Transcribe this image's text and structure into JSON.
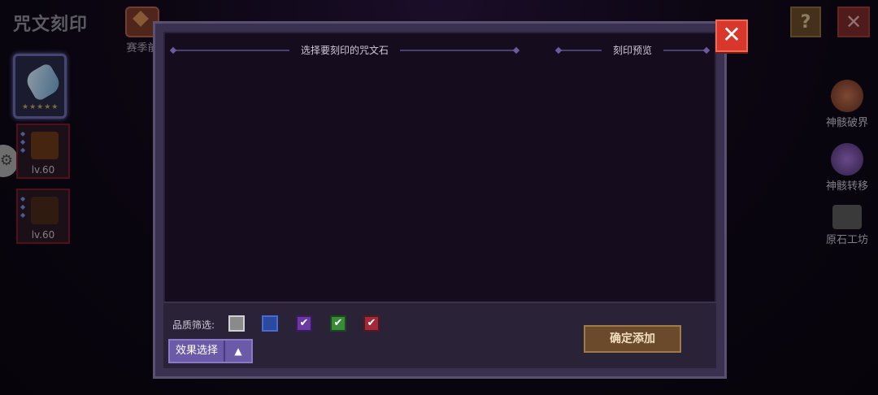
{
  "page": {
    "title": "咒文刻印"
  },
  "top_bar": {
    "season_label": "赛季前",
    "help_label": "?",
    "close_label": "✕"
  },
  "left_items": [
    {
      "selected": true,
      "stars": "★★★★★"
    },
    {
      "level": "lv.60"
    },
    {
      "level": "lv.60"
    }
  ],
  "right_menu": [
    {
      "label": "神骸破界",
      "icon": "relic-break-icon"
    },
    {
      "label": "神骸转移",
      "icon": "relic-transfer-icon"
    },
    {
      "label": "原石工坊",
      "icon": "workshop-icon"
    }
  ],
  "modal": {
    "left_header": "选择要刻印的咒文石",
    "right_header": "刻印预览",
    "close_label": "✕",
    "filter_label": "品质筛选:",
    "quality_filters": [
      {
        "color": "#8a8a8a",
        "checked": false
      },
      {
        "color": "#2a4aa0",
        "checked": false
      },
      {
        "color": "#6a3aa0",
        "checked": true
      },
      {
        "color": "#3a8a3a",
        "checked": true
      },
      {
        "color": "#a02a3a",
        "checked": true
      }
    ],
    "check_mark": "✔",
    "effect_select_label": "效果选择",
    "effect_select_arrow": "▲",
    "confirm_label": "确定添加"
  }
}
